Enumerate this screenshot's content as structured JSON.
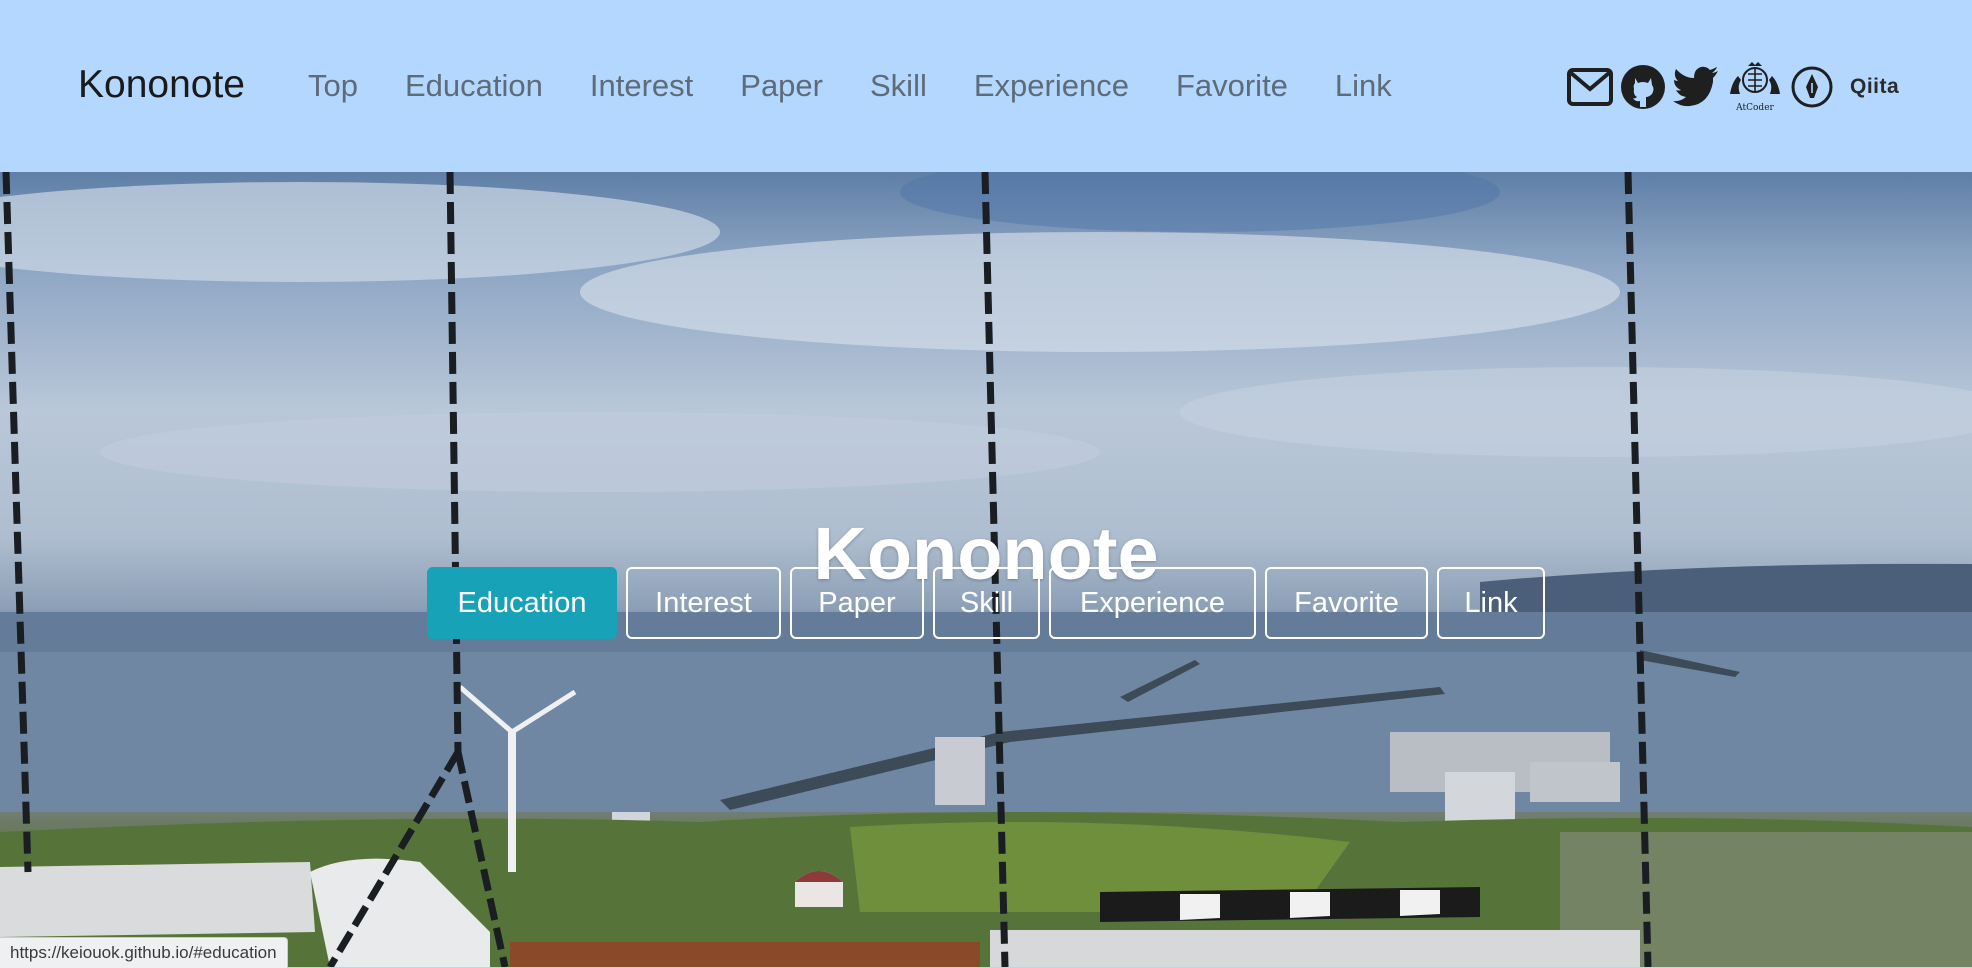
{
  "navbar": {
    "brand": "Kononote",
    "links": [
      "Top",
      "Education",
      "Interest",
      "Paper",
      "Skill",
      "Experience",
      "Favorite",
      "Link"
    ],
    "icons": [
      "mail-icon",
      "github-icon",
      "twitter-icon",
      "atcoder-icon",
      "pen-icon",
      "qiita-icon"
    ],
    "atcoder_caption": "AtCoder",
    "qiita_label": "Qiita",
    "background": "#b3d7ff"
  },
  "hero": {
    "title": "Kononote",
    "buttons": [
      {
        "label": "Education",
        "active": true
      },
      {
        "label": "Interest",
        "active": false
      },
      {
        "label": "Paper",
        "active": false
      },
      {
        "label": "Skill",
        "active": false
      },
      {
        "label": "Experience",
        "active": false
      },
      {
        "label": "Favorite",
        "active": false
      },
      {
        "label": "Link",
        "active": false
      }
    ],
    "active_color": "#17a2b8"
  },
  "status_bar": {
    "url": "https://keiouok.github.io/#education"
  }
}
